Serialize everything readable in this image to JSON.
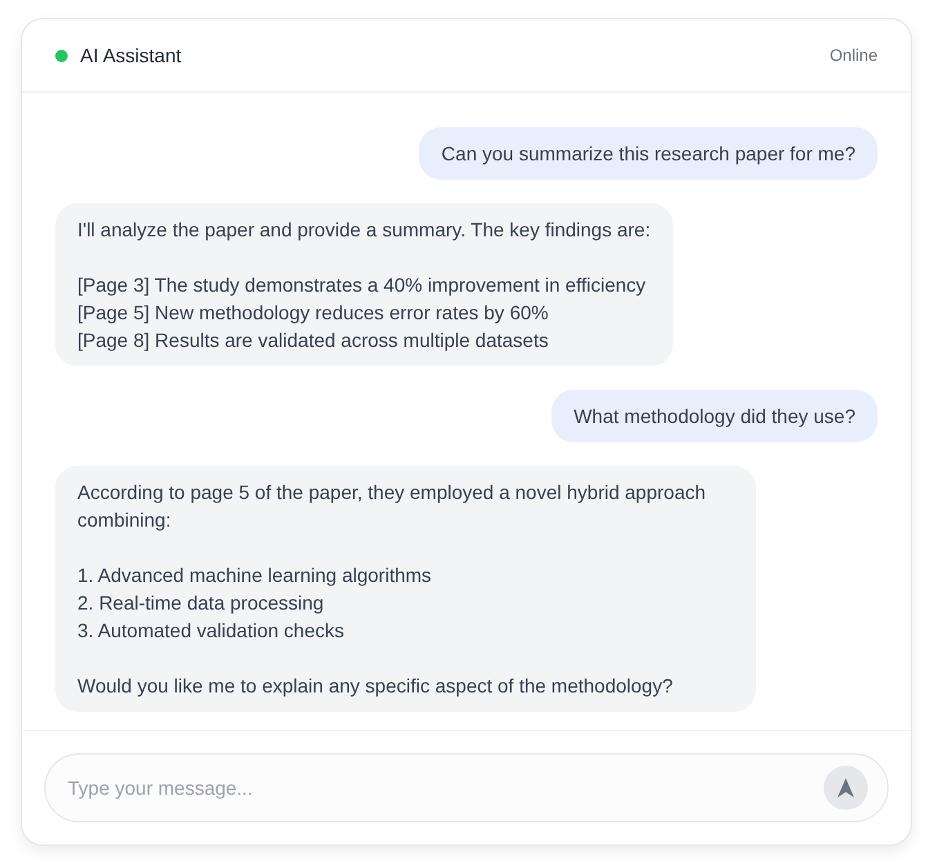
{
  "header": {
    "title": "AI Assistant",
    "status": "Online"
  },
  "messages": [
    {
      "kind": "user",
      "text": "Can you summarize this research paper for me?"
    },
    {
      "kind": "assistant",
      "text": "I'll analyze the paper and provide a summary. The key findings are:\n\n[Page 3] The study demonstrates a 40% improvement in efficiency\n[Page 5] New methodology reduces error rates by 60%\n[Page 8] Results are validated across multiple datasets"
    },
    {
      "kind": "user",
      "text": "What methodology did they use?"
    },
    {
      "kind": "assistant",
      "text": "According to page 5 of the paper, they employed a novel hybrid approach combining:\n\n1. Advanced machine learning algorithms\n2. Real-time data processing\n3. Automated validation checks\n\nWould you like me to explain any specific aspect of the methodology?"
    }
  ],
  "composer": {
    "placeholder": "Type your message...",
    "send_disabled": true
  }
}
